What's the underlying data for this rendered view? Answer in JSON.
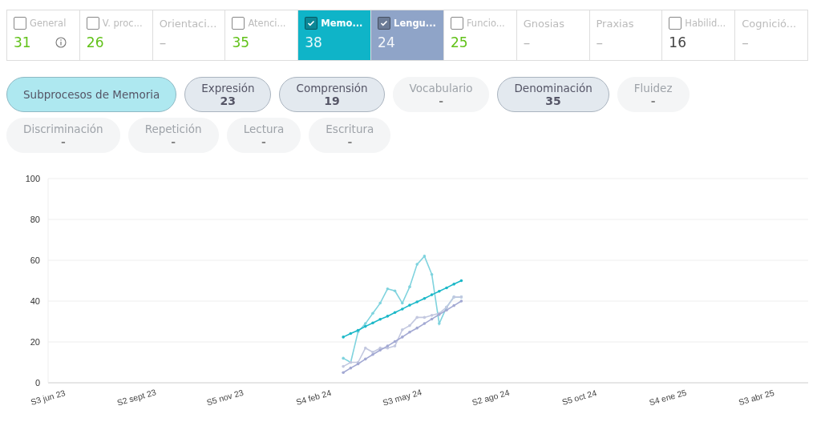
{
  "domains": [
    {
      "label": "General",
      "checkbox": true,
      "checked": false,
      "good": true,
      "info": true,
      "value_text": "31"
    },
    {
      "label": "V. proc...",
      "checkbox": true,
      "checked": false,
      "good": true,
      "value_text": "26"
    },
    {
      "label": "Orientaci...",
      "checkbox": false,
      "value_text": "–"
    },
    {
      "label": "Atenci...",
      "checkbox": true,
      "checked": false,
      "good": true,
      "value_text": "35"
    },
    {
      "label": "Memo...",
      "checkbox": true,
      "checked": true,
      "color": "#0fb4c8",
      "good": true,
      "value_text": "38"
    },
    {
      "label": "Lengu...",
      "checkbox": true,
      "checked": true,
      "color": "#8fa4c8",
      "good": true,
      "value_text": "24"
    },
    {
      "label": "Funcio...",
      "checkbox": true,
      "checked": false,
      "good": true,
      "value_text": "25"
    },
    {
      "label": "Gnosias",
      "checkbox": false,
      "value_text": "–"
    },
    {
      "label": "Praxias",
      "checkbox": false,
      "value_text": "–"
    },
    {
      "label": "Habilid...",
      "checkbox": true,
      "checked": false,
      "good": false,
      "value_text": "16"
    },
    {
      "label": "Cognició...",
      "checkbox": false,
      "value_text": "–"
    }
  ],
  "subprocesses": [
    {
      "label": "Subprocesos de Memoria",
      "selected": true,
      "disabled": false
    },
    {
      "label": "Expresión",
      "value": "23",
      "selected": false,
      "disabled": false
    },
    {
      "label": "Comprensión",
      "value": "19",
      "selected": false,
      "disabled": false
    },
    {
      "label": "Vocabulario",
      "value": "-",
      "selected": false,
      "disabled": true
    },
    {
      "label": "Denominación",
      "value": "35",
      "selected": false,
      "disabled": false
    },
    {
      "label": "Fluidez",
      "value": "-",
      "selected": false,
      "disabled": true
    },
    {
      "label": "Discriminación",
      "value": "-",
      "selected": false,
      "disabled": true
    },
    {
      "label": "Repetición",
      "value": "-",
      "selected": false,
      "disabled": true
    },
    {
      "label": "Lectura",
      "value": "-",
      "selected": false,
      "disabled": true
    },
    {
      "label": "Escritura",
      "value": "-",
      "selected": false,
      "disabled": true
    }
  ],
  "chart": {
    "chart_data": {
      "type": "line",
      "categories": [
        "S3 jun 23",
        null,
        null,
        null,
        null,
        null,
        null,
        null,
        null,
        null,
        null,
        null,
        "S2 sept 23",
        null,
        null,
        null,
        null,
        null,
        null,
        null,
        null,
        null,
        null,
        null,
        "S5 nov 23",
        null,
        null,
        null,
        null,
        null,
        null,
        null,
        null,
        null,
        null,
        null,
        "S4 feb 24",
        null,
        null,
        null,
        null,
        null,
        null,
        null,
        null,
        null,
        null,
        null,
        "S3 may 24",
        null,
        null,
        null,
        null,
        null,
        null,
        null,
        null,
        null,
        null,
        null,
        "S2 ago 24",
        null,
        null,
        null,
        null,
        null,
        null,
        null,
        null,
        null,
        null,
        null,
        "S5 oct 24",
        null,
        null,
        null,
        null,
        null,
        null,
        null,
        null,
        null,
        null,
        null,
        "S4 ene 25",
        null,
        null,
        null,
        null,
        null,
        null,
        null,
        null,
        null,
        null,
        null,
        "S3 abr 25",
        null,
        null,
        null,
        null,
        null,
        null,
        null
      ],
      "series": [
        {
          "color": "#7fd3de",
          "values": [
            null,
            null,
            null,
            null,
            null,
            null,
            null,
            null,
            null,
            null,
            null,
            null,
            null,
            null,
            null,
            null,
            null,
            null,
            null,
            null,
            null,
            null,
            null,
            null,
            null,
            null,
            null,
            null,
            null,
            null,
            null,
            null,
            null,
            null,
            null,
            null,
            null,
            null,
            null,
            null,
            12,
            10,
            25,
            29,
            34,
            39,
            46,
            45,
            39,
            47,
            58,
            62,
            53,
            29,
            37,
            42,
            42,
            null,
            null,
            null,
            null,
            null,
            null,
            null,
            null,
            null,
            null,
            null,
            null,
            null,
            null,
            null,
            null,
            null,
            null,
            null,
            null,
            null,
            null,
            null,
            null,
            null,
            null,
            null,
            null,
            null,
            null,
            null,
            null,
            null,
            null,
            null,
            null,
            null,
            null,
            null,
            null,
            null,
            null,
            null,
            null,
            null,
            null,
            null
          ]
        },
        {
          "color": "#c3c8e0",
          "values": [
            null,
            null,
            null,
            null,
            null,
            null,
            null,
            null,
            null,
            null,
            null,
            null,
            null,
            null,
            null,
            null,
            null,
            null,
            null,
            null,
            null,
            null,
            null,
            null,
            null,
            null,
            null,
            null,
            null,
            null,
            null,
            null,
            null,
            null,
            null,
            null,
            null,
            null,
            null,
            null,
            8,
            10,
            10,
            17,
            15,
            17,
            17,
            18,
            26,
            28,
            32,
            32,
            33,
            34,
            37,
            42,
            42,
            null,
            null,
            null,
            null,
            null,
            null,
            null,
            null,
            null,
            null,
            null,
            null,
            null,
            null,
            null,
            null,
            null,
            null,
            null,
            null,
            null,
            null,
            null,
            null,
            null,
            null,
            null,
            null,
            null,
            null,
            null,
            null,
            null,
            null,
            null,
            null,
            null,
            null,
            null,
            null,
            null,
            null,
            null,
            null,
            null,
            null,
            null
          ]
        },
        {
          "color": "#1cb8c8",
          "values": [
            null,
            null,
            null,
            null,
            null,
            null,
            null,
            null,
            null,
            null,
            null,
            null,
            null,
            null,
            null,
            null,
            null,
            null,
            null,
            null,
            null,
            null,
            null,
            null,
            null,
            null,
            null,
            null,
            null,
            null,
            null,
            null,
            null,
            null,
            null,
            null,
            null,
            null,
            null,
            null,
            22.4,
            24.1,
            25.7,
            27.6,
            29.3,
            31.1,
            32.6,
            34.4,
            36.1,
            38.0,
            39.6,
            41.3,
            43.1,
            44.8,
            46.5,
            48.3,
            50.0,
            null,
            null,
            null,
            null,
            null,
            null,
            null,
            null,
            null,
            null,
            null,
            null,
            null,
            null,
            null,
            null,
            null,
            null,
            null,
            null,
            null,
            null,
            null,
            null,
            null,
            null,
            null,
            null,
            null,
            null,
            null,
            null,
            null,
            null,
            null,
            null,
            null,
            null,
            null,
            null,
            null,
            null,
            null,
            null,
            null,
            null,
            null
          ]
        },
        {
          "color": "#a3a9d3",
          "values": [
            null,
            null,
            null,
            null,
            null,
            null,
            null,
            null,
            null,
            null,
            null,
            null,
            null,
            null,
            null,
            null,
            null,
            null,
            null,
            null,
            null,
            null,
            null,
            null,
            null,
            null,
            null,
            null,
            null,
            null,
            null,
            null,
            null,
            null,
            null,
            null,
            null,
            null,
            null,
            null,
            5.0,
            7.2,
            9.2,
            11.6,
            13.8,
            16.0,
            18.0,
            20.2,
            22.4,
            24.8,
            26.8,
            29.0,
            31.2,
            33.4,
            35.6,
            37.8,
            40.0,
            null,
            null,
            null,
            null,
            null,
            null,
            null,
            null,
            null,
            null,
            null,
            null,
            null,
            null,
            null,
            null,
            null,
            null,
            null,
            null,
            null,
            null,
            null,
            null,
            null,
            null,
            null,
            null,
            null,
            null,
            null,
            null,
            null,
            null,
            null,
            null,
            null,
            null,
            null,
            null,
            null,
            null,
            null,
            null,
            null,
            null,
            null
          ]
        }
      ],
      "grid": true,
      "ylim": [
        0,
        100
      ],
      "yticks": [
        0,
        20,
        40,
        60,
        80,
        100
      ]
    }
  }
}
